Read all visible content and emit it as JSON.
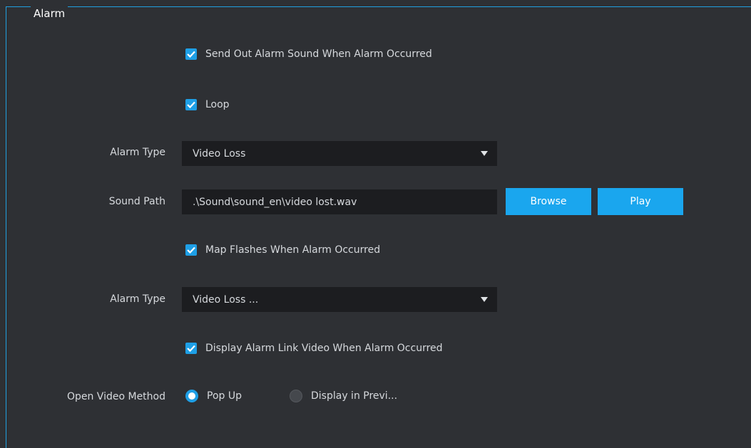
{
  "group": {
    "title": "Alarm"
  },
  "checkboxes": {
    "send_alarm_sound": {
      "label": "Send Out Alarm Sound When Alarm Occurred",
      "checked": true
    },
    "loop": {
      "label": "Loop",
      "checked": true
    },
    "map_flashes": {
      "label": "Map Flashes When Alarm Occurred",
      "checked": true
    },
    "display_link_video": {
      "label": "Display Alarm Link Video When Alarm Occurred",
      "checked": true
    }
  },
  "alarm_type_1": {
    "label": "Alarm Type",
    "value": "Video Loss"
  },
  "sound_path": {
    "label": "Sound Path",
    "value": ".\\Sound\\sound_en\\video lost.wav",
    "browse": "Browse",
    "play": "Play"
  },
  "alarm_type_2": {
    "label": "Alarm Type",
    "value": "Video Loss ..."
  },
  "open_video_method": {
    "label": "Open Video Method",
    "options": [
      "Pop Up",
      "Display in Previ..."
    ],
    "selected": "Pop Up"
  },
  "colors": {
    "accent": "#1e9fe6",
    "background": "#2e3034",
    "field": "#1c1d20"
  }
}
